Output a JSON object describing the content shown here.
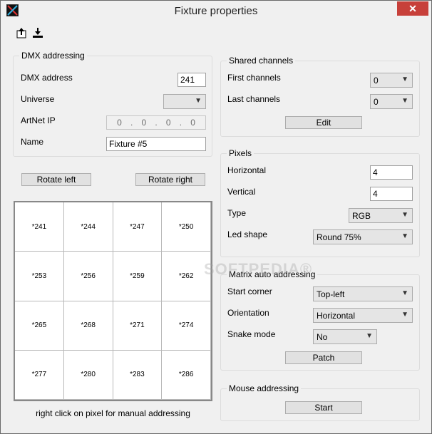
{
  "window": {
    "title": "Fixture properties",
    "close_label": "✕"
  },
  "toolbar": {
    "export_icon": "export-icon",
    "import_icon": "import-icon"
  },
  "dmx": {
    "group_label": "DMX addressing",
    "address_label": "DMX address",
    "address_value": "241",
    "universe_label": "Universe",
    "universe_value": "",
    "artnet_label": "ArtNet IP",
    "artnet_octets": [
      "0",
      "0",
      "0",
      "0"
    ],
    "name_label": "Name",
    "name_value": "Fixture #5"
  },
  "rotate": {
    "left_label": "Rotate left",
    "right_label": "Rotate right"
  },
  "pixel_grid": {
    "cells": [
      "*241",
      "*244",
      "*247",
      "*250",
      "*253",
      "*256",
      "*259",
      "*262",
      "*265",
      "*268",
      "*271",
      "*274",
      "*277",
      "*280",
      "*283",
      "*286"
    ],
    "hint": "right click on pixel for manual addressing"
  },
  "shared": {
    "group_label": "Shared channels",
    "first_label": "First channels",
    "first_value": "0",
    "last_label": "Last channels",
    "last_value": "0",
    "edit_label": "Edit"
  },
  "pixels": {
    "group_label": "Pixels",
    "horizontal_label": "Horizontal",
    "horizontal_value": "4",
    "vertical_label": "Vertical",
    "vertical_value": "4",
    "type_label": "Type",
    "type_value": "RGB",
    "led_label": "Led shape",
    "led_value": "Round 75%"
  },
  "matrix": {
    "group_label": "Matrix auto addressing",
    "start_label": "Start corner",
    "start_value": "Top-left",
    "orientation_label": "Orientation",
    "orientation_value": "Horizontal",
    "snake_label": "Snake mode",
    "snake_value": "No",
    "patch_label": "Patch"
  },
  "mouse": {
    "group_label": "Mouse addressing",
    "start_label": "Start"
  },
  "watermark": "SOFTPEDIA®"
}
